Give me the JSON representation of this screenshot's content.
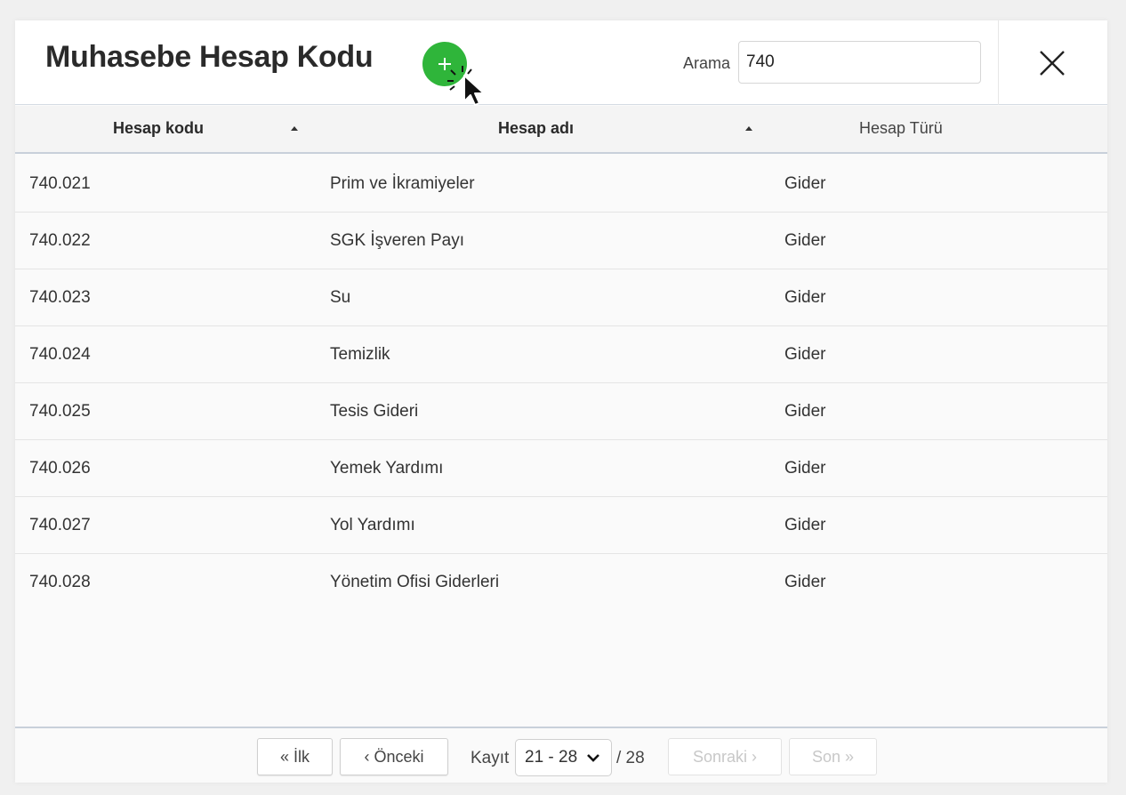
{
  "header": {
    "title": "Muhasebe Hesap Kodu",
    "search_label": "Arama",
    "search_value": "740"
  },
  "table": {
    "columns": [
      "Hesap kodu",
      "Hesap adı",
      "Hesap Türü"
    ],
    "rows": [
      {
        "code": "740.021",
        "name": "Prim ve İkramiyeler",
        "type": "Gider"
      },
      {
        "code": "740.022",
        "name": "SGK İşveren Payı",
        "type": "Gider"
      },
      {
        "code": "740.023",
        "name": "Su",
        "type": "Gider"
      },
      {
        "code": "740.024",
        "name": "Temizlik",
        "type": "Gider"
      },
      {
        "code": "740.025",
        "name": "Tesis Gideri",
        "type": "Gider"
      },
      {
        "code": "740.026",
        "name": "Yemek Yardımı",
        "type": "Gider"
      },
      {
        "code": "740.027",
        "name": "Yol Yardımı",
        "type": "Gider"
      },
      {
        "code": "740.028",
        "name": "Yönetim Ofisi Giderleri",
        "type": "Gider"
      }
    ]
  },
  "pagination": {
    "first_label": "« İlk",
    "prev_label": "‹ Önceki",
    "records_label": "Kayıt",
    "range_value": "21 - 28",
    "total_label": "/ 28",
    "next_label": "Sonraki ›",
    "last_label": "Son »"
  },
  "colors": {
    "add_button": "#2fb53a",
    "header_bg": "#ffffff",
    "divider": "#c8d0da"
  },
  "icons": {
    "add": "plus-icon",
    "close": "close-icon",
    "sort": "sort-ascending-icon",
    "select": "chevron-down-icon"
  }
}
